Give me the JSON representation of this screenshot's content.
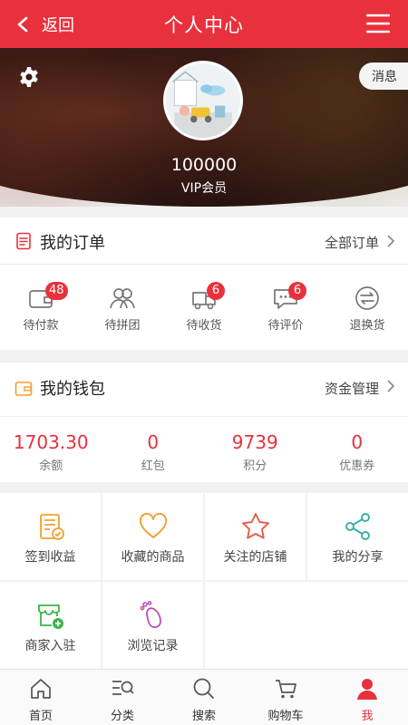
{
  "header": {
    "back_label": "返回",
    "title": "个人中心"
  },
  "profile": {
    "message_label": "消息",
    "user_id": "100000",
    "level": "VIP会员"
  },
  "orders": {
    "title": "我的订单",
    "all_label": "全部订单",
    "items": [
      {
        "label": "待付款",
        "badge": "48",
        "icon": "wallet-icon"
      },
      {
        "label": "待拼团",
        "badge": "",
        "icon": "group-icon"
      },
      {
        "label": "待收货",
        "badge": "6",
        "icon": "truck-icon"
      },
      {
        "label": "待评价",
        "badge": "6",
        "icon": "comment-icon"
      },
      {
        "label": "退换货",
        "badge": "",
        "icon": "return-icon"
      }
    ]
  },
  "wallet": {
    "title": "我的钱包",
    "manage_label": "资金管理",
    "items": [
      {
        "value": "1703.30",
        "label": "余额"
      },
      {
        "value": "0",
        "label": "红包"
      },
      {
        "value": "9739",
        "label": "积分"
      },
      {
        "value": "0",
        "label": "优惠券"
      }
    ]
  },
  "services": [
    {
      "label": "签到收益",
      "icon": "checkin-icon",
      "color": "#f0a030"
    },
    {
      "label": "收藏的商品",
      "icon": "heart-icon",
      "color": "#f0a030"
    },
    {
      "label": "关注的店铺",
      "icon": "star-icon",
      "color": "#e85a4a"
    },
    {
      "label": "我的分享",
      "icon": "share-icon",
      "color": "#3aaea8"
    },
    {
      "label": "商家入驻",
      "icon": "store-icon",
      "color": "#3cb54a"
    },
    {
      "label": "浏览记录",
      "icon": "footprint-icon",
      "color": "#c04ab8"
    }
  ],
  "nav": [
    {
      "label": "首页",
      "icon": "home-icon"
    },
    {
      "label": "分类",
      "icon": "category-icon"
    },
    {
      "label": "搜索",
      "icon": "search-icon"
    },
    {
      "label": "购物车",
      "icon": "cart-icon"
    },
    {
      "label": "我",
      "icon": "user-icon",
      "active": true
    }
  ],
  "colors": {
    "accent": "#e8313c"
  }
}
